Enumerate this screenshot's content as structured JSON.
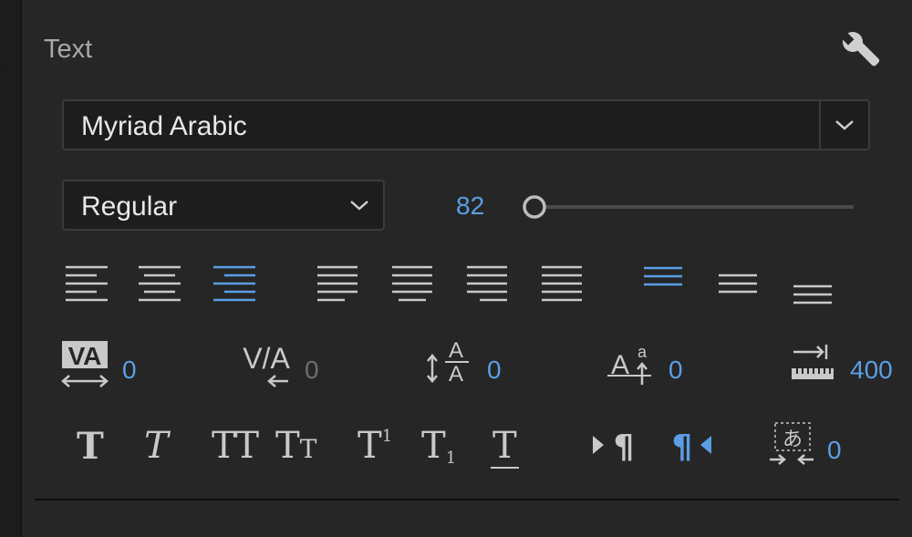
{
  "panel": {
    "title": "Text",
    "settings_icon": "wrench-icon"
  },
  "font": {
    "family": "Myriad Arabic",
    "style": "Regular",
    "size": "82",
    "size_slider_fraction": 0.0
  },
  "alignment": {
    "paragraph_buttons": [
      "align-left",
      "align-center",
      "align-right",
      "justify-last-left",
      "justify-last-center",
      "justify-last-right",
      "justify-all"
    ],
    "paragraph_selected": "align-right",
    "vertical_buttons": [
      "align-top",
      "align-middle",
      "align-bottom"
    ],
    "vertical_selected": "align-top"
  },
  "spacing": {
    "kerning": "0",
    "tracking": "0",
    "leading": "0",
    "baseline_shift": "0",
    "tab_width": "400"
  },
  "formatting": {
    "buttons": [
      "faux-bold",
      "faux-italic",
      "all-caps",
      "small-caps",
      "superscript",
      "subscript",
      "underline"
    ],
    "direction_buttons": [
      "left-to-right",
      "right-to-left"
    ],
    "direction_selected": "right-to-left",
    "tsume": "0"
  },
  "colors": {
    "accent": "#5b9ee6",
    "icon": "#c9c9c9",
    "background": "#262626"
  }
}
